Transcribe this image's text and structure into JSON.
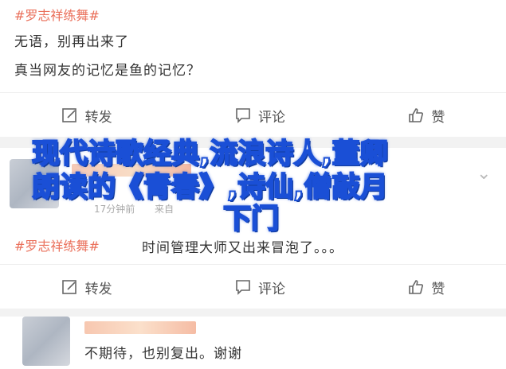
{
  "post1": {
    "tag": "#罗志祥练舞#",
    "line1": "无语，别再出来了",
    "line2": "真当网友的记忆是鱼的记忆？"
  },
  "actions1": {
    "repost": "转发",
    "comment": "评论",
    "like": "赞"
  },
  "overlay": {
    "line1": "现代诗歌经典,流浪诗人,董卿",
    "line2": "朗读的《青春》,诗仙,僧敲月",
    "line3": "下门"
  },
  "post2": {
    "time": "17分钟前",
    "source": "来自",
    "tag": "#罗志祥练舞#",
    "text": "时间管理大师又出来冒泡了。。。"
  },
  "actions2": {
    "repost": "转发",
    "comment": "评论",
    "like": "赞"
  },
  "post3": {
    "text": "不期待，也别复出。谢谢"
  },
  "colors": {
    "tag": "#eb7350",
    "overlay_stroke": "#1a4fd6"
  }
}
